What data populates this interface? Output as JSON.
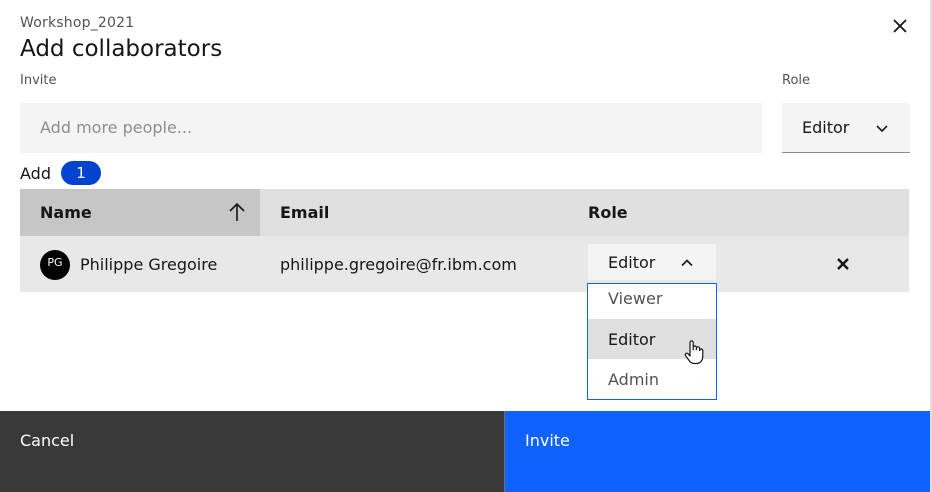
{
  "modal": {
    "project_name": "Workshop_2021",
    "title": "Add collaborators"
  },
  "invite": {
    "label": "Invite",
    "placeholder": "Add more people...",
    "value": ""
  },
  "role": {
    "label": "Role",
    "selected": "Editor"
  },
  "add": {
    "label": "Add",
    "count": "1"
  },
  "table": {
    "columns": [
      "Name",
      "Email",
      "Role"
    ],
    "sort_column": "Name",
    "sort_direction": "ascending",
    "rows": [
      {
        "initials": "PG",
        "name": "Philippe Gregoire",
        "email": "philippe.gregoire@fr.ibm.com",
        "role": "Editor"
      }
    ]
  },
  "role_dropdown": {
    "options": [
      "Viewer",
      "Editor",
      "Admin"
    ],
    "highlighted": "Editor"
  },
  "footer": {
    "cancel_label": "Cancel",
    "invite_label": "Invite"
  },
  "colors": {
    "primary": "#0f62fe",
    "badge": "#0043ce",
    "secondary_button": "#393939"
  }
}
